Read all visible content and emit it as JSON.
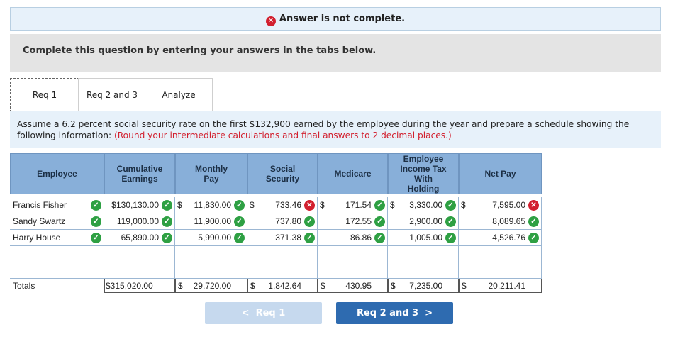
{
  "status": {
    "text": "Answer is not complete.",
    "icon": "x-circle-icon",
    "color": "#d2202f"
  },
  "instructions": "Complete this question by entering your answers in the tabs below.",
  "tabs": [
    "Req 1",
    "Req 2 and 3",
    "Analyze"
  ],
  "prompt": {
    "text": "Assume a 6.2 percent social security rate on the first $132,900 earned by the employee during the year and prepare a schedule showing the following information: ",
    "hint": "(Round your intermediate calculations and final answers to 2 decimal places.)"
  },
  "table": {
    "headers": [
      "Employee",
      "Cumulative\nEarnings",
      "Monthly\nPay",
      "Social\nSecurity",
      "Medicare",
      "Employee\nIncome Tax\nWith\nHolding",
      "Net Pay"
    ],
    "rows": [
      {
        "employee": "Francis Fisher",
        "cumulative": "$130,130.00",
        "monthly": "11,830.00",
        "monthly_dollar": "$",
        "social": "733.46",
        "social_dollar": "$",
        "social_status": "incorrect",
        "medicare": "171.54",
        "medicare_dollar": "$",
        "tax": "3,330.00",
        "tax_dollar": "$",
        "net": "7,595.00",
        "net_dollar": "$",
        "net_status": "incorrect"
      },
      {
        "employee": "Sandy Swartz",
        "cumulative": "119,000.00",
        "monthly": "11,900.00",
        "social": "737.80",
        "medicare": "172.55",
        "tax": "2,900.00",
        "net": "8,089.65"
      },
      {
        "employee": "Harry House",
        "cumulative": "65,890.00",
        "monthly": "5,990.00",
        "social": "371.38",
        "medicare": "86.86",
        "tax": "1,005.00",
        "net": "4,526.76"
      }
    ],
    "totals": {
      "label": "Totals",
      "cumulative": "$315,020.00",
      "monthly": "29,720.00",
      "monthly_dollar": "$",
      "social": "1,842.64",
      "social_dollar": "$",
      "medicare": "430.95",
      "medicare_dollar": "$",
      "tax": "7,235.00",
      "tax_dollar": "$",
      "net": "20,211.41",
      "net_dollar": "$"
    }
  },
  "nav": {
    "prev": "Req 1",
    "next": "Req 2 and 3"
  },
  "colors": {
    "header_bg": "#88afd9",
    "next_bg": "#2e6bb0",
    "prev_bg": "#c6d9ee",
    "correct": "#2ea043",
    "incorrect": "#d2202f"
  }
}
